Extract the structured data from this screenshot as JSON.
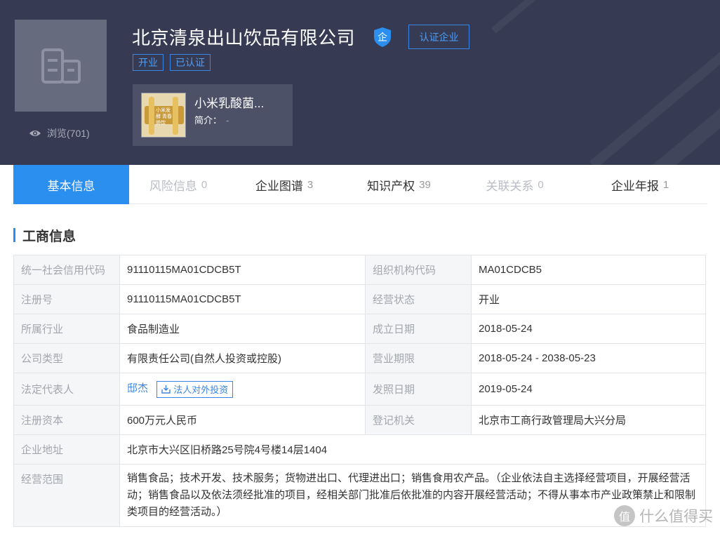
{
  "header": {
    "company_name": "北京清泉出山饮品有限公司",
    "badge_text": "企",
    "cert_button": "认证企业",
    "tags": [
      "开业",
      "已认证"
    ],
    "views_label": "浏览(701)"
  },
  "product": {
    "title": "小米乳酸菌...",
    "desc_label": "简介：",
    "desc_value": "-",
    "image_text": "小米发酵 青春肠饮"
  },
  "tabs": [
    {
      "label": "基本信息",
      "count": ""
    },
    {
      "label": "风险信息",
      "count": "0"
    },
    {
      "label": "企业图谱",
      "count": "3"
    },
    {
      "label": "知识产权",
      "count": "39"
    },
    {
      "label": "关联关系",
      "count": "0"
    },
    {
      "label": "企业年报",
      "count": "1"
    }
  ],
  "section_title": "工商信息",
  "info": {
    "credit_code_label": "统一社会信用代码",
    "credit_code": "91110115MA01CDCB5T",
    "org_code_label": "组织机构代码",
    "org_code": "MA01CDCB5",
    "reg_no_label": "注册号",
    "reg_no": "91110115MA01CDCB5T",
    "status_label": "经营状态",
    "status": "开业",
    "industry_label": "所属行业",
    "industry": "食品制造业",
    "founded_label": "成立日期",
    "founded": "2018-05-24",
    "type_label": "公司类型",
    "type": "有限责任公司(自然人投资或控股)",
    "term_label": "营业期限",
    "term": "2018-05-24 - 2038-05-23",
    "legal_rep_label": "法定代表人",
    "legal_rep": "邸杰",
    "legal_rep_invest": "法人对外投资",
    "license_date_label": "发照日期",
    "license_date": "2019-05-24",
    "capital_label": "注册资本",
    "capital": "600万元人民币",
    "authority_label": "登记机关",
    "authority": "北京市工商行政管理局大兴分局",
    "address_label": "企业地址",
    "address": "北京市大兴区旧桥路25号院4号楼14层1404",
    "scope_label": "经营范围",
    "scope": "销售食品；技术开发、技术服务；货物进出口、代理进出口；销售食用农产品。（企业依法自主选择经营项目，开展经营活动；销售食品以及依法须经批准的项目，经相关部门批准后依批准的内容开展经营活动；不得从事本市产业政策禁止和限制类项目的经营活动。）"
  },
  "watermark": {
    "icon_text": "值",
    "text": "什么值得买"
  },
  "colors": {
    "header_bg": "#363b53",
    "accent": "#2b8ff0",
    "label_bg": "#f5f6f8"
  }
}
